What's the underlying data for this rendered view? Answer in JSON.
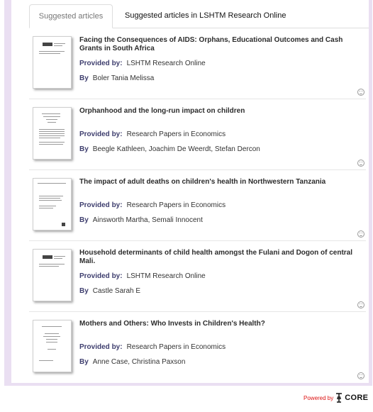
{
  "tabs": [
    {
      "label": "Suggested articles",
      "active": true
    },
    {
      "label": "Suggested articles in LSHTM Research Online",
      "active": false
    }
  ],
  "labels": {
    "provided_by": "Provided by:",
    "by": "By"
  },
  "articles": [
    {
      "title": "Facing the Consequences of AIDS: Orphans, Educational Outcomes and Cash Grants in South Africa",
      "provider": "LSHTM Research Online",
      "authors": "Boler Tania Melissa"
    },
    {
      "title": "Orphanhood and the long-run impact on children",
      "provider": "Research Papers in Economics",
      "authors": "Beegle Kathleen, Joachim De Weerdt, Stefan Dercon"
    },
    {
      "title": "The impact of adult deaths on children's health in Northwestern Tanzania",
      "provider": "Research Papers in Economics",
      "authors": "Ainsworth Martha, Semali Innocent"
    },
    {
      "title": "Household determinants of child health amongst the Fulani and Dogon of central Mali.",
      "provider": "LSHTM Research Online",
      "authors": "Castle Sarah E"
    },
    {
      "title": "Mothers and Others: Who Invests in Children's Health?",
      "provider": "Research Papers in Economics",
      "authors": "Anne Case, Christina Paxson"
    }
  ],
  "footer": {
    "powered_by": "Powered by",
    "brand": "CORE"
  },
  "colors": {
    "frame": "#eadff2",
    "accent": "#3e3e6e",
    "powered_red": "#dd1111"
  }
}
